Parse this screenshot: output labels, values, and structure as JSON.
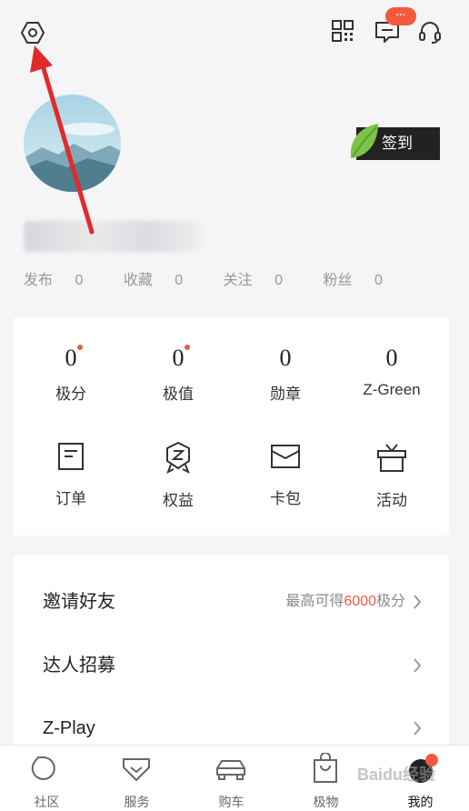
{
  "header": {
    "settings_icon": "hexagon-gear-icon",
    "qr_icon": "qr-code-icon",
    "message_icon": "chat-bubble-icon",
    "message_badge": "···",
    "service_icon": "headset-icon"
  },
  "profile": {
    "checkin_label": "签到",
    "stats": [
      {
        "label": "发布",
        "count": "0"
      },
      {
        "label": "收藏",
        "count": "0"
      },
      {
        "label": "关注",
        "count": "0"
      },
      {
        "label": "粉丝",
        "count": "0"
      }
    ]
  },
  "metrics": [
    {
      "value": "0",
      "label": "极分",
      "has_dot": true
    },
    {
      "value": "0",
      "label": "极值",
      "has_dot": true
    },
    {
      "value": "0",
      "label": "勋章",
      "has_dot": false
    },
    {
      "value": "0",
      "label": "Z-Green",
      "has_dot": false
    }
  ],
  "actions": [
    {
      "label": "订单",
      "icon": "order-icon"
    },
    {
      "label": "权益",
      "icon": "benefit-badge-icon"
    },
    {
      "label": "卡包",
      "icon": "card-wallet-icon"
    },
    {
      "label": "活动",
      "icon": "gift-icon"
    }
  ],
  "menu": [
    {
      "title": "邀请好友",
      "right_prefix": "最高可得",
      "right_highlight": "6000",
      "right_suffix": "极分"
    },
    {
      "title": "达人招募"
    },
    {
      "title": "Z-Play"
    }
  ],
  "tabbar": [
    {
      "label": "社区",
      "icon": "community-icon"
    },
    {
      "label": "服务",
      "icon": "service-icon"
    },
    {
      "label": "购车",
      "icon": "car-icon"
    },
    {
      "label": "极物",
      "icon": "shopping-bag-icon"
    },
    {
      "label": "我的",
      "icon": "profile-icon",
      "active": true
    }
  ],
  "watermark": "Baidu经验",
  "colors": {
    "accent": "#f4593f",
    "checkin_bg": "#222222",
    "leaf": "#7cc34a"
  }
}
